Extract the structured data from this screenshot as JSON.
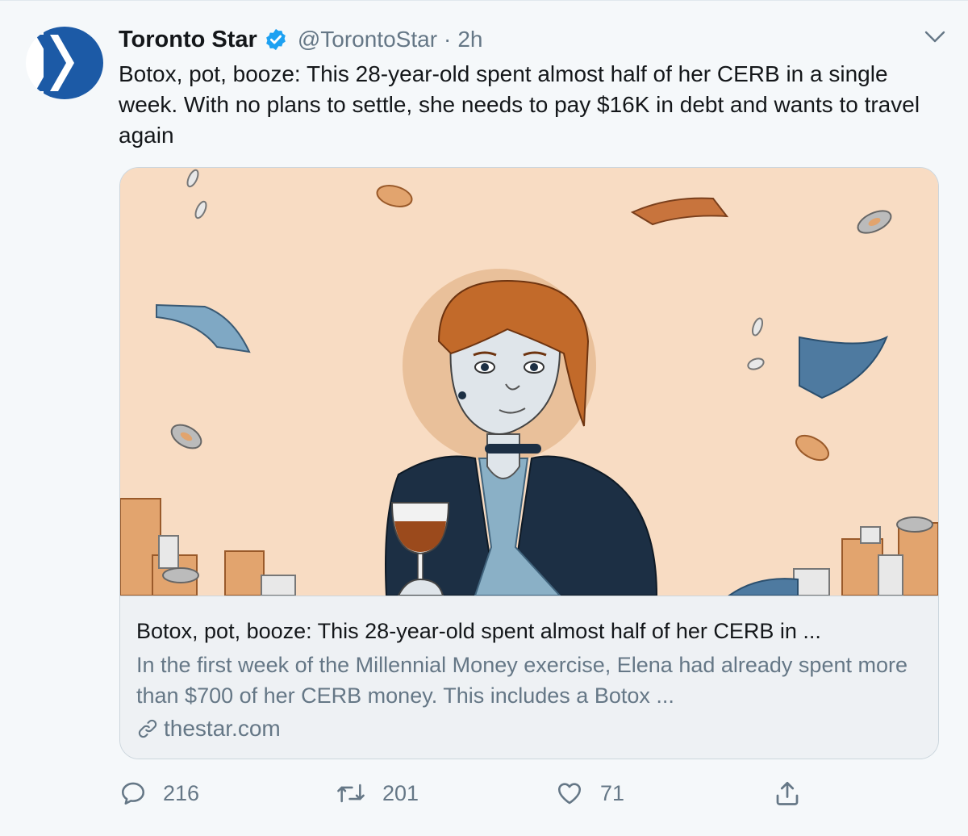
{
  "tweet": {
    "author_name": "Toronto Star",
    "handle": "@TorontoStar",
    "separator": "·",
    "time": "2h",
    "text": "Botox, pot, booze: This 28-year-old spent almost half of her CERB in a single week. With no plans to settle, she needs to pay $16K in debt and wants to travel again"
  },
  "card": {
    "title": "Botox, pot, booze: This 28-year-old spent almost half of her CERB in ...",
    "description": "In the first week of the Millennial Money exercise, Elena had already spent more than $700 of her CERB money. This includes a Botox ...",
    "domain": "thestar.com"
  },
  "actions": {
    "replies": "216",
    "retweets": "201",
    "likes": "71"
  },
  "icons": {
    "verified": "verified-badge-icon",
    "caret": "chevron-down-icon",
    "link": "link-icon",
    "reply": "reply-icon",
    "retweet": "retweet-icon",
    "like": "heart-icon",
    "share": "share-icon"
  },
  "colors": {
    "brand_blue": "#1c5aa6",
    "verified": "#1da1f2",
    "secondary_text": "#657786",
    "card_image_bg": "#f8dcc3"
  }
}
